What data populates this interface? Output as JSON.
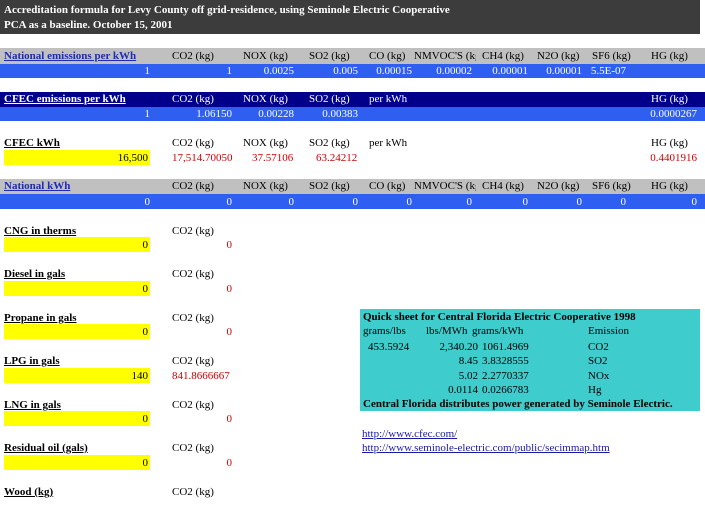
{
  "title": {
    "line1": "Accreditation formula for Levy County off grid-residence, using Seminole Electric Cooperative",
    "line2": "PCA as a baseline.      October 15, 2001"
  },
  "colors": {
    "title_bg": "#3c3c3c",
    "gray_header": "#c0c0c0",
    "blue_row": "#2f5ff0",
    "navy_header": "#00008b",
    "yellow": "#ffff00",
    "teal": "#3fcccc",
    "red_value": "#cc0000"
  },
  "national_emissions": {
    "label": "National emissions per kWh",
    "headers": [
      "CO2 (kg)",
      "NOX (kg)",
      "SO2 (kg)",
      "CO (kg)",
      "NMVOC'S (kg",
      "CH4 (kg)",
      "N2O (kg)",
      "SF6 (kg)",
      "HG (kg)"
    ],
    "values": [
      "1",
      "1",
      "0.0025",
      "0.005",
      "0.00015",
      "0.00002",
      "0.00001",
      "0.00001",
      "5.5E-07"
    ]
  },
  "cfec_emissions": {
    "label": "CFEC emissions per kWh",
    "headers": [
      "CO2 (kg)",
      "NOX (kg)",
      "SO2 (kg)",
      "per kWh",
      "HG (kg)"
    ],
    "values": [
      "1",
      "1.06150",
      "0.00228",
      "0.00383",
      "0.0000267"
    ]
  },
  "cfec_kwh": {
    "label": "CFEC kWh",
    "headers": [
      "CO2 (kg)",
      "NOX (kg)",
      "SO2 (kg)",
      "per kWh",
      "HG (kg)"
    ],
    "input": "16,500",
    "values": [
      "17,514.70050",
      "37.57106",
      "63.24212",
      "0.4401916"
    ]
  },
  "national_kwh": {
    "label": "National kWh",
    "headers": [
      "CO2 (kg)",
      "NOX (kg)",
      "SO2 (kg)",
      "CO (kg)",
      "NMVOC'S (kg",
      "CH4 (kg)",
      "N2O (kg)",
      "SF6 (kg)",
      "HG (kg)"
    ],
    "values": [
      "0",
      "0",
      "0",
      "0",
      "0",
      "0",
      "0",
      "0",
      "0",
      "0"
    ]
  },
  "fuels": [
    {
      "label": "CNG in therms",
      "unit": "CO2 (kg)",
      "input": "0",
      "result": "0"
    },
    {
      "label": "Diesel in gals",
      "unit": "CO2 (kg)",
      "input": "0",
      "result": "0"
    },
    {
      "label": "Propane in gals",
      "unit": "CO2 (kg)",
      "input": "0",
      "result": "0"
    },
    {
      "label": "LPG in gals",
      "unit": "CO2 (kg)",
      "input": "140",
      "result": "841.8666667"
    },
    {
      "label": "LNG in gals",
      "unit": "CO2 (kg)",
      "input": "0",
      "result": "0"
    },
    {
      "label": "Residual oil (gals)",
      "unit": "CO2 (kg)",
      "input": "0",
      "result": "0"
    },
    {
      "label": "Wood (kg)",
      "unit": "CO2 (kg)"
    }
  ],
  "quick_sheet": {
    "title": "Quick sheet for Central Florida Electric Cooperative 1998",
    "headers": [
      "grams/lbs",
      "lbs/MWh",
      "grams/kWh",
      "Emission"
    ],
    "grams_per_lb": "453.5924",
    "rows": [
      {
        "lbs": "2,340.20",
        "grams": "1061.4969",
        "emission": "CO2"
      },
      {
        "lbs": "8.45",
        "grams": "3.8328555",
        "emission": "SO2"
      },
      {
        "lbs": "5.02",
        "grams": "2.2770337",
        "emission": "NOx"
      },
      {
        "lbs": "0.0114",
        "grams": "0.0266783",
        "emission": "Hg"
      }
    ],
    "footer": "Central Florida distributes power generated by Seminole Electric."
  },
  "links": [
    "http://www.cfec.com/",
    "http://www.seminole-electric.com/public/secimmap.htm"
  ]
}
